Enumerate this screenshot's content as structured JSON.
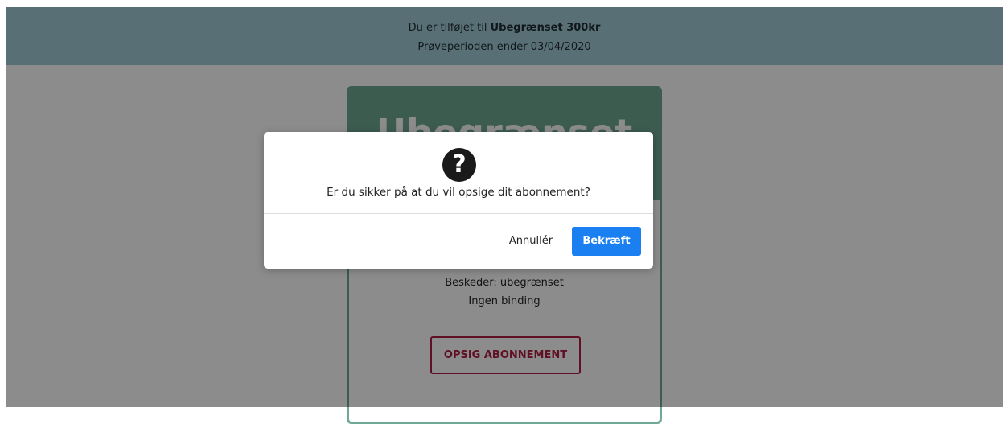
{
  "banner": {
    "prefix": "Du er tilføjet til",
    "plan_name": "Ubegrænset 300kr",
    "trial_link": "Prøveperioden ender 03/04/2020"
  },
  "plan_card": {
    "title": "Ubegrænset",
    "features": [
      "Beskeder: ubegrænset",
      "Ingen binding"
    ],
    "cancel_subscription_label": "OPSIG ABONNEMENT"
  },
  "dialog": {
    "icon": "question-circle-icon",
    "message": "Er du sikker på at du vil opsige dit abonnement?",
    "cancel_label": "Annullér",
    "confirm_label": "Bekræft"
  },
  "colors": {
    "banner_bg": "#9fcbd6",
    "card_accent": "#6fa893",
    "danger": "#b01e43",
    "primary": "#1a7ff0"
  }
}
